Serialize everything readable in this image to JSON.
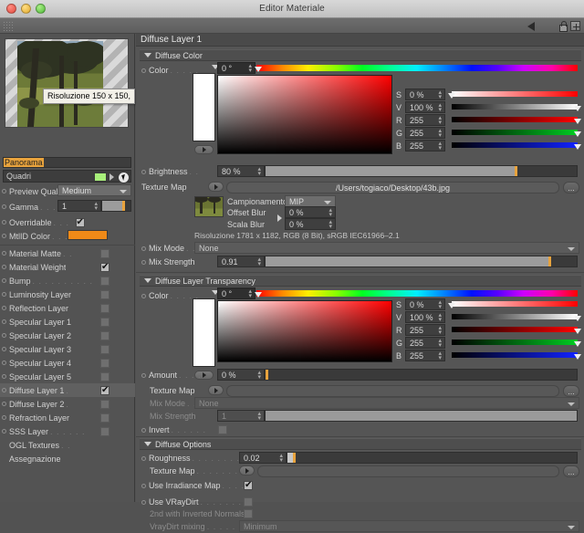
{
  "window": {
    "title": "Editor Materiale",
    "traffic": [
      "close",
      "minimize",
      "zoom"
    ]
  },
  "toolbar": {
    "back_arrow": "back-arrow-icon",
    "lock": "lock-icon",
    "expand": "expand-button"
  },
  "left_panel": {
    "preview": {
      "tooltip": "Risoluzione 150 x 150,",
      "name_value": "Panorama"
    },
    "quadri": {
      "label": "Quadri",
      "swatch_color": "#a8f07a"
    },
    "preview_quality": {
      "label": "Preview Quality",
      "value": "Medium"
    },
    "gamma": {
      "label": "Gamma",
      "value": "1",
      "dots": ". . . . . . ."
    },
    "overridable": {
      "label": "Overridable",
      "dots": ". . .",
      "checked": true
    },
    "mtlid_color": {
      "label": "MtlID Color",
      "dots": ". . .",
      "color": "#f08a18"
    },
    "channels": [
      {
        "label": "Material Matte",
        "dots": ". .",
        "checked": false,
        "selected": false
      },
      {
        "label": "Material Weight",
        "dots": "",
        "checked": true,
        "selected": false
      },
      {
        "label": "Bump",
        "dots": ". . . . . . . . . .",
        "checked": false,
        "selected": false
      },
      {
        "label": "Luminosity Layer",
        "dots": "",
        "checked": false,
        "selected": false
      },
      {
        "label": "Reflection Layer",
        "dots": "",
        "checked": false,
        "selected": false
      },
      {
        "label": "Specular Layer 1",
        "dots": "",
        "checked": false,
        "selected": false
      },
      {
        "label": "Specular Layer 2",
        "dots": "",
        "checked": false,
        "selected": false
      },
      {
        "label": "Specular Layer 3",
        "dots": "",
        "checked": false,
        "selected": false
      },
      {
        "label": "Specular Layer 4",
        "dots": "",
        "checked": false,
        "selected": false
      },
      {
        "label": "Specular Layer 5",
        "dots": "",
        "checked": false,
        "selected": false
      },
      {
        "label": "Diffuse Layer 1",
        "dots": ".",
        "checked": true,
        "selected": true
      },
      {
        "label": "Diffuse Layer 2",
        "dots": ".",
        "checked": false,
        "selected": false
      },
      {
        "label": "Refraction Layer",
        "dots": "",
        "checked": false,
        "selected": false
      },
      {
        "label": "SSS Layer",
        "dots": ". . . . . .",
        "checked": false,
        "selected": false
      }
    ],
    "extra_items": [
      {
        "label": "OGL Textures",
        "dots": ". ."
      },
      {
        "label": "Assegnazione",
        "dots": ""
      }
    ]
  },
  "right_panel": {
    "title": "Diffuse Layer 1",
    "diffuse_color": {
      "group_label": "Diffuse Color",
      "color_label": "Color",
      "color_dots": ". . . . .",
      "hue_value": "0 °",
      "channels": [
        {
          "name": "S",
          "value": "0 %",
          "knob_pct": 0
        },
        {
          "name": "V",
          "value": "100 %",
          "knob_pct": 100
        },
        {
          "name": "R",
          "value": "255",
          "knob_pct": 100
        },
        {
          "name": "G",
          "value": "255",
          "knob_pct": 100
        },
        {
          "name": "B",
          "value": "255",
          "knob_pct": 100
        }
      ],
      "brightness": {
        "label": "Brightness",
        "dots": ". .",
        "value": "80 %",
        "fill_pct": 80
      },
      "texture_map": {
        "label": "Texture Map",
        "path": "/Users/togiaco/Desktop/43b.jpg",
        "browse": "..."
      },
      "campionamento": {
        "label": "Campionamento",
        "value": "MIP"
      },
      "offset_blur": {
        "label": "Offset Blur",
        "value": "0 %"
      },
      "scala_blur": {
        "label": "Scala Blur",
        "value": "0 %"
      },
      "resolution_info": "Risoluzione 1781 x 1182, RGB (8 Bit), sRGB IEC61966–2.1",
      "mix_mode": {
        "label": "Mix Mode",
        "dots": ". . .",
        "value": "None"
      },
      "mix_strength": {
        "label": "Mix Strength",
        "value": "0.91",
        "fill_pct": 91
      }
    },
    "diffuse_transparency": {
      "group_label": "Diffuse Layer Transparency",
      "color_label": "Color",
      "color_dots": ". . . . .",
      "hue_value": "0 °",
      "channels": [
        {
          "name": "S",
          "value": "0 %",
          "knob_pct": 0
        },
        {
          "name": "V",
          "value": "100 %",
          "knob_pct": 100
        },
        {
          "name": "R",
          "value": "255",
          "knob_pct": 100
        },
        {
          "name": "G",
          "value": "255",
          "knob_pct": 100
        },
        {
          "name": "B",
          "value": "255",
          "knob_pct": 100
        }
      ],
      "amount": {
        "label": "Amount",
        "dots": ". . . .",
        "value": "0 %",
        "fill_pct": 0
      },
      "texture_map": {
        "label": "Texture Map",
        "path": "",
        "browse": "..."
      },
      "mix_mode": {
        "label": "Mix Mode",
        "dots": ". . .",
        "value": "None"
      },
      "mix_strength": {
        "label": "Mix Strength",
        "value": "1",
        "fill_pct": 100
      },
      "invert": {
        "label": "Invert",
        "dots": ". . . . . .",
        "checked": false
      }
    },
    "diffuse_options": {
      "group_label": "Diffuse Options",
      "roughness": {
        "label": "Roughness",
        "dots": ". . . . . . . . . . . . .",
        "value": "0.02",
        "fill_pct": 2
      },
      "texture_map": {
        "label": "Texture Map",
        "dots": ". . . . . . . . . . . .",
        "path": "",
        "browse": "..."
      },
      "use_irradiance_map": {
        "label": "Use Irradiance Map",
        "dots": ". . . . . . .",
        "checked": true
      },
      "use_vraydirt": {
        "label": "Use VRayDirt",
        "dots": ". . . . . . . . . . . .",
        "checked": false
      },
      "inverted_normals": {
        "label": "2nd with Inverted Normals",
        "checked": false
      },
      "vraydirt_mixing": {
        "label": "VrayDirt mixing",
        "dots": ". . . . . . . . .",
        "value": "Minimum"
      }
    }
  }
}
